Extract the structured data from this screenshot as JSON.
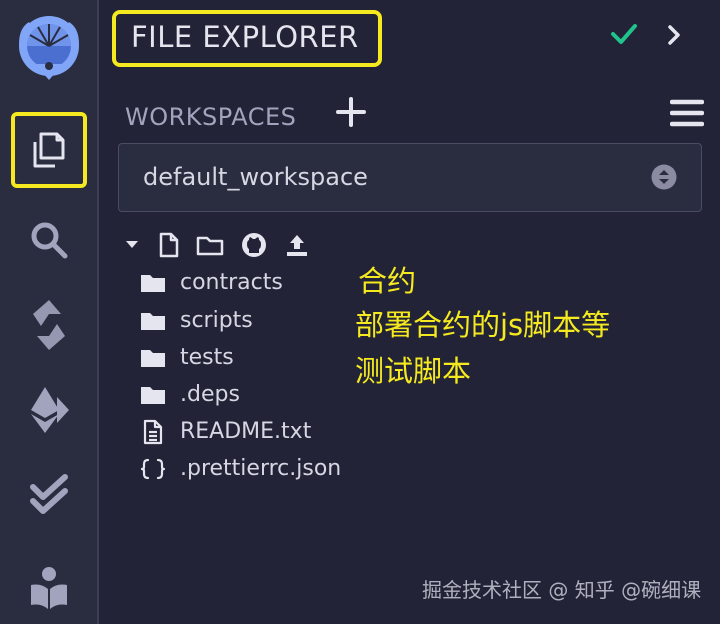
{
  "panel": {
    "title": "FILE EXPLORER"
  },
  "workspace": {
    "label": "WORKSPACES",
    "selected": "default_workspace"
  },
  "tree": {
    "items": [
      {
        "label": "contracts",
        "type": "folder"
      },
      {
        "label": "scripts",
        "type": "folder"
      },
      {
        "label": "tests",
        "type": "folder"
      },
      {
        "label": ".deps",
        "type": "folder"
      },
      {
        "label": "README.txt",
        "type": "file"
      },
      {
        "label": ".prettierrc.json",
        "type": "json"
      }
    ]
  },
  "annotations": {
    "line1": "合约",
    "line2": "部署合约的js脚本等",
    "line3": "测试脚本"
  },
  "watermark": "掘金技术社区 @ 知乎 @碗细课",
  "colors": {
    "highlight": "#f5ea1f",
    "check": "#1fc38b",
    "rail_bg": "#2a2c3f",
    "panel_bg": "#222336",
    "icon": "#a2a3bd"
  },
  "icons": {
    "rail": [
      "remix-logo-icon",
      "file-explorer-icon",
      "search-icon",
      "solidity-compiler-icon",
      "deploy-run-icon",
      "unit-test-icon",
      "learn-icon"
    ]
  }
}
